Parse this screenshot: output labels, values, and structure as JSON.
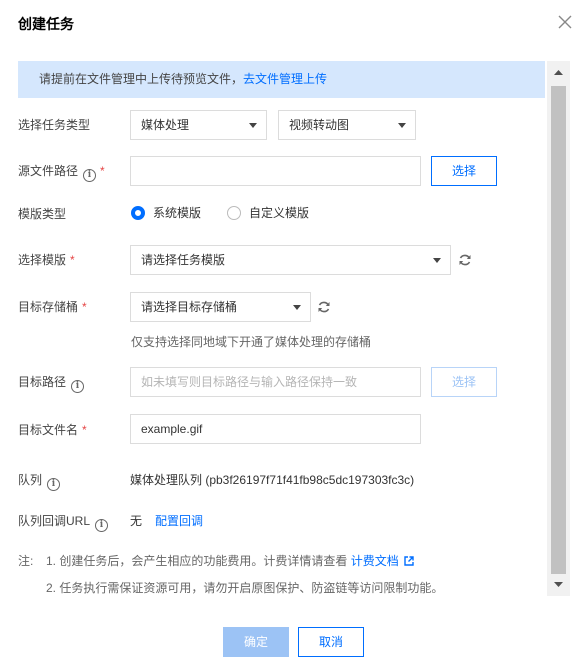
{
  "dialog": {
    "title": "创建任务"
  },
  "notice": {
    "text": "请提前在文件管理中上传待预览文件，",
    "link": "去文件管理上传"
  },
  "form": {
    "task_type": {
      "label": "选择任务类型",
      "primary": "媒体处理",
      "secondary": "视频转动图"
    },
    "source_path": {
      "label": "源文件路径",
      "value": "",
      "select_button": "选择"
    },
    "template_type": {
      "label": "模版类型",
      "options": [
        "系统模版",
        "自定义模版"
      ],
      "selected": "系统模版"
    },
    "template": {
      "label": "选择模版",
      "placeholder": "请选择任务模版"
    },
    "target_bucket": {
      "label": "目标存储桶",
      "placeholder": "请选择目标存储桶",
      "hint": "仅支持选择同地域下开通了媒体处理的存储桶"
    },
    "target_path": {
      "label": "目标路径",
      "placeholder": "如未填写则目标路径与输入路径保持一致",
      "select_button": "选择"
    },
    "target_filename": {
      "label": "目标文件名",
      "value": "example.gif"
    },
    "queue": {
      "label": "队列",
      "value": "媒体处理队列 (pb3f26197f71f41fb98c5dc197303fc3c)"
    },
    "callback": {
      "label": "队列回调URL",
      "value": "无",
      "link": "配置回调"
    }
  },
  "notes": {
    "prefix": "注:",
    "item1": "1. 创建任务后，会产生相应的功能费用。计费详情请查看",
    "item1_link": "计费文档",
    "item2": "2. 任务执行需保证资源可用，请勿开启原图保护、防盗链等访问限制功能。"
  },
  "footer": {
    "ok": "确定",
    "cancel": "取消"
  },
  "colors": {
    "accent": "#006eff",
    "notice_bg": "#d5e7fd",
    "required": "#e54545"
  }
}
